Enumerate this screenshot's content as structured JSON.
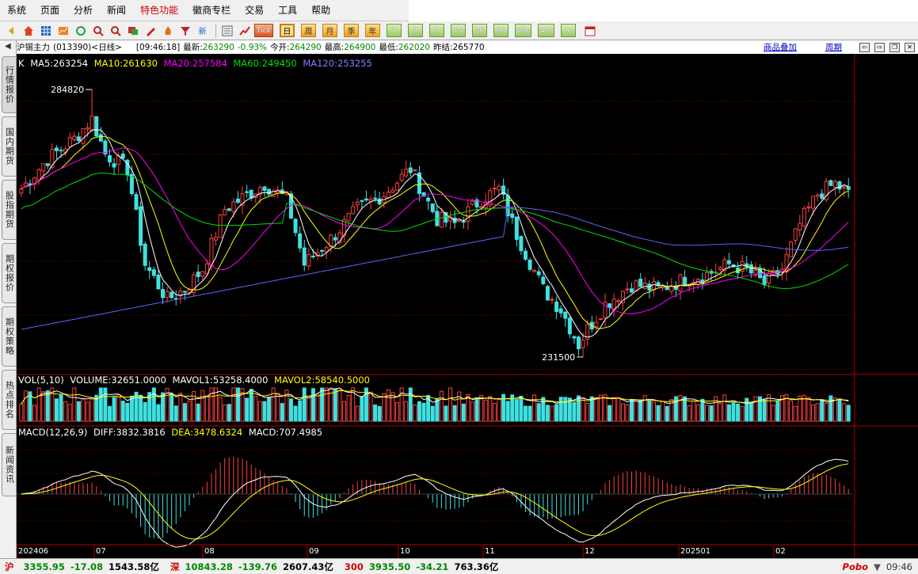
{
  "menu": [
    {
      "label": "系统",
      "hot": false
    },
    {
      "label": "页面",
      "hot": false
    },
    {
      "label": "分析",
      "hot": false
    },
    {
      "label": "新闻",
      "hot": false
    },
    {
      "label": "特色功能",
      "hot": true
    },
    {
      "label": "徽商专栏",
      "hot": false
    },
    {
      "label": "交易",
      "hot": false
    },
    {
      "label": "工具",
      "hot": false
    },
    {
      "label": "帮助",
      "hot": false
    }
  ],
  "toolbar": {
    "periods": [
      "日",
      "周",
      "月",
      "季",
      "年",
      "1",
      "3",
      "5",
      "15",
      "30",
      "60",
      "2hr",
      "4hr",
      "Y"
    ],
    "active_period": "日",
    "tick_label": "Tick",
    "new_label": "新"
  },
  "sidebar": {
    "tabs": [
      "行情报价",
      "国内期货",
      "股指期货",
      "期权报价",
      "期权策略",
      "热点排名",
      "新闻资讯"
    ]
  },
  "header": {
    "instrument": "沪锡主力",
    "code": "(013390)",
    "period": "<日线>",
    "time": "[09:46:18]",
    "latest_label": "最新:",
    "latest": "263290",
    "change": "-0.93%",
    "open_label": "今开:",
    "open": "264290",
    "high_label": "最高:",
    "high": "264900",
    "low_label": "最低:",
    "low": "262020",
    "prev_label": "昨结:",
    "prev": "265770",
    "overlay_link": "商品叠加",
    "cycle_link": "周期"
  },
  "legend_k": {
    "k": "K",
    "ma5": "MA5:263254",
    "ma10": "MA10:261630",
    "ma20": "MA20:257584",
    "ma60": "MA60:249450",
    "ma120": "MA120:253255"
  },
  "legend_vol": {
    "vol": "VOL(5,10)",
    "volume": "VOLUME:32651.0000",
    "mavol1": "MAVOL1:53258.4000",
    "mavol2": "MAVOL2:58540.5000"
  },
  "legend_macd": {
    "macd": "MACD(12,26,9)",
    "diff": "DIFF:3832.3816",
    "dea": "DEA:3478.6324",
    "value": "MACD:707.4985"
  },
  "colors": {
    "up": "#ff4040",
    "down": "#40e0e0",
    "ma5": "#ffffff",
    "ma10": "#ffff00",
    "ma20": "#ff00ff",
    "ma60": "#00e000",
    "ma120": "#6060ff",
    "grid": "#800000"
  },
  "chart_data": {
    "type": "candlestick",
    "price_range": [
      231500,
      284820
    ],
    "high_marker": "284820",
    "low_marker": "231500",
    "x_labels": [
      "202406",
      "07",
      "08",
      "09",
      "10",
      "11",
      "12",
      "202501",
      "02"
    ],
    "anchors": [
      [
        0,
        265000
      ],
      [
        6,
        271000
      ],
      [
        12,
        275000
      ],
      [
        16,
        279000
      ],
      [
        19,
        272000
      ],
      [
        24,
        269000
      ],
      [
        28,
        250000
      ],
      [
        33,
        243000
      ],
      [
        37,
        245000
      ],
      [
        41,
        249000
      ],
      [
        46,
        261000
      ],
      [
        55,
        266000
      ],
      [
        60,
        263000
      ],
      [
        64,
        250000
      ],
      [
        70,
        255000
      ],
      [
        76,
        261000
      ],
      [
        82,
        264000
      ],
      [
        88,
        269000
      ],
      [
        94,
        259000
      ],
      [
        98,
        258000
      ],
      [
        104,
        263000
      ],
      [
        108,
        265000
      ],
      [
        112,
        256000
      ],
      [
        118,
        245000
      ],
      [
        122,
        241000
      ],
      [
        126,
        234000
      ],
      [
        128,
        237000
      ],
      [
        132,
        242000
      ],
      [
        138,
        246000
      ],
      [
        144,
        245000
      ],
      [
        150,
        247000
      ],
      [
        155,
        248000
      ],
      [
        160,
        250000
      ],
      [
        164,
        249000
      ],
      [
        168,
        246000
      ],
      [
        172,
        249000
      ],
      [
        176,
        258000
      ],
      [
        180,
        264000
      ],
      [
        184,
        266000
      ],
      [
        187,
        264000
      ]
    ],
    "vol_range": [
      0,
      150000
    ],
    "macd_range": [
      -7000,
      7000
    ],
    "diff_latest": 3832.3816,
    "dea_latest": 3478.6324,
    "macd_latest": 707.4985,
    "volume_latest": 32651,
    "mavol1_latest": 53258.4,
    "mavol2_latest": 58540.5
  },
  "status": {
    "sh_label": "沪",
    "sh_value": "3355.95",
    "sh_change": "-17.08",
    "sh_amount": "1543.58亿",
    "sz_label": "深",
    "sz_value": "10843.28",
    "sz_change": "-139.76",
    "sz_amount": "2607.43亿",
    "hs_label": "300",
    "hs_value": "3935.50",
    "hs_change": "-34.21",
    "hs_amount": "763.36亿",
    "brand": "Pobo",
    "time": "09:46"
  }
}
